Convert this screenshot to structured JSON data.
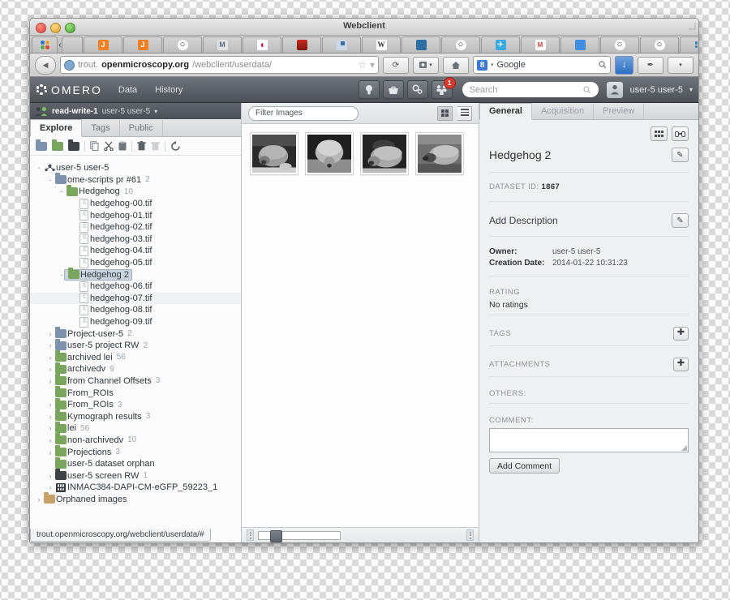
{
  "window": {
    "title": "Webclient"
  },
  "browser": {
    "tabs": [
      {
        "name": "apps-tab",
        "icon": "apps-grid-icon"
      },
      {
        "name": "back-chevron",
        "icon": "chevron-left-icon"
      },
      {
        "name": "tab-blank",
        "icon": "blank-icon"
      },
      {
        "name": "tab-jenkins-1",
        "icon": "jenkins-icon"
      },
      {
        "name": "tab-jenkins-2",
        "icon": "jenkins-icon"
      },
      {
        "name": "tab-github-1",
        "icon": "github-icon"
      },
      {
        "name": "tab-mendeley",
        "icon": "m-icon"
      },
      {
        "name": "tab-debian",
        "icon": "debian-icon"
      },
      {
        "name": "tab-redhat",
        "icon": "redhat-icon"
      },
      {
        "name": "tab-docs",
        "icon": "document-icon"
      },
      {
        "name": "tab-wikipedia",
        "icon": "wikipedia-icon"
      },
      {
        "name": "tab-trello",
        "icon": "trello-icon"
      },
      {
        "name": "tab-github-2",
        "icon": "github-icon"
      },
      {
        "name": "tab-twitter",
        "icon": "twitter-icon"
      },
      {
        "name": "tab-gmail",
        "icon": "gmail-icon"
      },
      {
        "name": "tab-messages",
        "icon": "message-icon"
      },
      {
        "name": "tab-github-3",
        "icon": "github-icon"
      },
      {
        "name": "tab-github-4",
        "icon": "github-icon"
      },
      {
        "name": "tab-omero-1",
        "icon": "omero-icon"
      },
      {
        "name": "tab-github-5",
        "icon": "github-icon"
      },
      {
        "name": "tab-omero-active",
        "icon": "omero-icon",
        "active": true
      },
      {
        "name": "tab-omero-2",
        "icon": "omero-icon"
      }
    ],
    "tabstrip_overflow": "›",
    "new_tab": "+",
    "tabstrip_menu": "▾",
    "url": {
      "scheme": "trout.",
      "host": "openmicroscopy.org",
      "path": "/webclient/userdata/"
    },
    "back_glyph": "◀",
    "star_glyph": "☆",
    "reload_glyph": "⟳",
    "home_glyph": "⌂",
    "search": {
      "engine": "8",
      "placeholder": "Google",
      "value": "Google"
    },
    "download_glyph": "↓",
    "addon_glyph": "✒"
  },
  "omero": {
    "brand": "OMERO",
    "nav": [
      "Data",
      "History"
    ],
    "toolbar_icons": [
      "lightbulb-icon",
      "basket-icon",
      "scripts-gear-icon",
      "groups-icon"
    ],
    "notification_count": "1",
    "search_placeholder": "Search",
    "user": "user-5 user-5",
    "user_caret": "▾"
  },
  "group_bar": {
    "permission": "read-write-1",
    "user": "user-5 user-5",
    "caret": "▾"
  },
  "left_panel": {
    "tabs": [
      {
        "label": "Explore",
        "active": true
      },
      {
        "label": "Tags",
        "active": false
      },
      {
        "label": "Public",
        "active": false
      }
    ],
    "toolbar": [
      {
        "name": "new-project-button",
        "icon": "folder-blue-icon"
      },
      {
        "name": "new-dataset-button",
        "icon": "folder-green-icon"
      },
      {
        "name": "new-screen-button",
        "icon": "folder-dark-icon"
      },
      {
        "name": "copy-button",
        "icon": "copy-icon",
        "glyph": "❐"
      },
      {
        "name": "cut-button",
        "icon": "scissors-icon",
        "glyph": "✂"
      },
      {
        "name": "paste-button",
        "icon": "clipboard-icon",
        "glyph": "ὌB"
      },
      {
        "name": "delete-button",
        "icon": "trash-icon",
        "glyph": "Ὕ1"
      },
      {
        "name": "delete-disabled-button",
        "icon": "trash-disabled-icon",
        "glyph": "Ὕ1"
      },
      {
        "name": "refresh-button",
        "icon": "refresh-icon",
        "glyph": "↻"
      }
    ],
    "tree": [
      {
        "indent": 0,
        "exp": "-",
        "icon": "user",
        "label": "user-5 user-5",
        "count": ""
      },
      {
        "indent": 1,
        "exp": "-",
        "icon": "folder-blue",
        "label": "ome-scripts pr #61",
        "count": "2"
      },
      {
        "indent": 2,
        "exp": "-",
        "icon": "folder-green",
        "label": "Hedgehog",
        "count": "10"
      },
      {
        "indent": 3,
        "exp": "",
        "icon": "file",
        "label": "hedgehog-00.tif",
        "count": ""
      },
      {
        "indent": 3,
        "exp": "",
        "icon": "file",
        "label": "hedgehog-01.tif",
        "count": ""
      },
      {
        "indent": 3,
        "exp": "",
        "icon": "file",
        "label": "hedgehog-02.tif",
        "count": ""
      },
      {
        "indent": 3,
        "exp": "",
        "icon": "file",
        "label": "hedgehog-03.tif",
        "count": ""
      },
      {
        "indent": 3,
        "exp": "",
        "icon": "file",
        "label": "hedgehog-04.tif",
        "count": ""
      },
      {
        "indent": 3,
        "exp": "",
        "icon": "file",
        "label": "hedgehog-05.tif",
        "count": ""
      },
      {
        "indent": 2,
        "exp": "-",
        "icon": "folder-green",
        "label": "Hedgehog 2",
        "count": "",
        "selected": true
      },
      {
        "indent": 3,
        "exp": "",
        "icon": "file",
        "label": "hedgehog-06.tif",
        "count": ""
      },
      {
        "indent": 3,
        "exp": "",
        "icon": "file",
        "label": "hedgehog-07.tif",
        "count": "",
        "hl": true
      },
      {
        "indent": 3,
        "exp": "",
        "icon": "file",
        "label": "hedgehog-08.tif",
        "count": ""
      },
      {
        "indent": 3,
        "exp": "",
        "icon": "file",
        "label": "hedgehog-09.tif",
        "count": ""
      },
      {
        "indent": 1,
        "exp": "›",
        "icon": "folder-blue",
        "label": "Project-user-5",
        "count": "2"
      },
      {
        "indent": 1,
        "exp": "›",
        "icon": "folder-blue",
        "label": "user-5 project RW",
        "count": "2"
      },
      {
        "indent": 1,
        "exp": "›",
        "icon": "folder-green",
        "label": "archived lei",
        "count": "56"
      },
      {
        "indent": 1,
        "exp": "›",
        "icon": "folder-green",
        "label": "archivedv",
        "count": "9"
      },
      {
        "indent": 1,
        "exp": "›",
        "icon": "folder-green",
        "label": "from Channel Offsets",
        "count": "3"
      },
      {
        "indent": 1,
        "exp": "",
        "icon": "folder-green",
        "label": "From_ROIs",
        "count": ""
      },
      {
        "indent": 1,
        "exp": "›",
        "icon": "folder-green",
        "label": "From_ROIs",
        "count": "3"
      },
      {
        "indent": 1,
        "exp": "›",
        "icon": "folder-green",
        "label": "Kymograph results",
        "count": "3"
      },
      {
        "indent": 1,
        "exp": "›",
        "icon": "folder-green",
        "label": "lei",
        "count": "56"
      },
      {
        "indent": 1,
        "exp": "›",
        "icon": "folder-green",
        "label": "non-archivedv",
        "count": "10"
      },
      {
        "indent": 1,
        "exp": "›",
        "icon": "folder-green",
        "label": "Projections",
        "count": "3"
      },
      {
        "indent": 1,
        "exp": "",
        "icon": "folder-green",
        "label": "user-5 dataset orphan",
        "count": ""
      },
      {
        "indent": 1,
        "exp": "›",
        "icon": "folder-dark",
        "label": "user-5 screen RW",
        "count": "1"
      },
      {
        "indent": 1,
        "exp": "›",
        "icon": "plate",
        "label": "INMAC384-DAPI-CM-eGFP_59223_1",
        "count": ""
      },
      {
        "indent": 0,
        "exp": "›",
        "icon": "folder-orange",
        "label": "Orphaned images",
        "count": ""
      }
    ]
  },
  "center_panel": {
    "filter_placeholder": "Filter Images",
    "view_grid_icon": "grid-view-icon",
    "view_list_icon": "list-view-icon",
    "thumbnail_count": 4,
    "thumbnails": [
      {
        "name": "thumbnail-hedgehog-06"
      },
      {
        "name": "thumbnail-hedgehog-07"
      },
      {
        "name": "thumbnail-hedgehog-08"
      },
      {
        "name": "thumbnail-hedgehog-09"
      }
    ]
  },
  "right_panel": {
    "tabs": [
      {
        "label": "General",
        "active": true
      },
      {
        "label": "Acquisition",
        "active": false
      },
      {
        "label": "Preview",
        "active": false
      }
    ],
    "grid_icon": "thumbnail-grid-icon",
    "link_icon": "link-chain-icon",
    "title": "Hedgehog 2",
    "edit_glyph": "✎",
    "dataset_id_label": "DATASET ID:",
    "dataset_id_value": "1867",
    "description_placeholder": "Add Description",
    "owner_label": "Owner:",
    "owner_value": "user-5 user-5",
    "creation_label": "Creation Date:",
    "creation_value": "2014-01-22 10:31:23",
    "rating_label": "RATING",
    "rating_value": "No ratings",
    "tags_label": "TAGS",
    "attachments_label": "ATTACHMENTS",
    "others_label": "OTHERS:",
    "comment_label": "COMMENT:",
    "comment_value": "",
    "add_comment_label": "Add Comment",
    "plus_glyph": "✚"
  },
  "status_bar": {
    "text": "trout.openmicroscopy.org/webclient/userdata/#"
  },
  "colors": {
    "omero_header": "#5a6065",
    "accent_green": "#79a65c",
    "accent_blue": "#7b93ad",
    "selection": "#c9d4de",
    "notification_red": "#d63b2f"
  }
}
